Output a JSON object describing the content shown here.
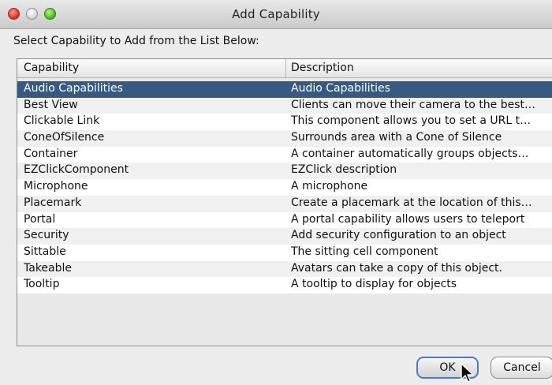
{
  "window": {
    "title": "Add Capability"
  },
  "instruction": "Select Capability to Add from the List Below:",
  "table": {
    "columns": [
      "Capability",
      "Description"
    ],
    "selected_index": 0,
    "rows": [
      {
        "capability": "Audio Capabilities",
        "description": "Audio Capabilities"
      },
      {
        "capability": "Best View",
        "description": "Clients can move their camera to the best…"
      },
      {
        "capability": "Clickable Link",
        "description": "This component allows you to set a URL t…"
      },
      {
        "capability": "ConeOfSilence",
        "description": "Surrounds area with a Cone of Silence"
      },
      {
        "capability": "Container",
        "description": "A container automatically groups objects…"
      },
      {
        "capability": "EZClickComponent",
        "description": "EZClick description"
      },
      {
        "capability": "Microphone",
        "description": "A microphone"
      },
      {
        "capability": "Placemark",
        "description": "Create a placemark at the location of this…"
      },
      {
        "capability": "Portal",
        "description": "A portal capability allows users to teleport"
      },
      {
        "capability": "Security",
        "description": "Add security configuration to an object"
      },
      {
        "capability": "Sittable",
        "description": "The sitting cell component"
      },
      {
        "capability": "Takeable",
        "description": "Avatars can take a copy of this object."
      },
      {
        "capability": "Tooltip",
        "description": "A tooltip to display for objects"
      }
    ]
  },
  "buttons": {
    "ok": "OK",
    "cancel": "Cancel"
  },
  "colors": {
    "selection": "#375a80",
    "default_button_border": "#4d7cc7"
  }
}
